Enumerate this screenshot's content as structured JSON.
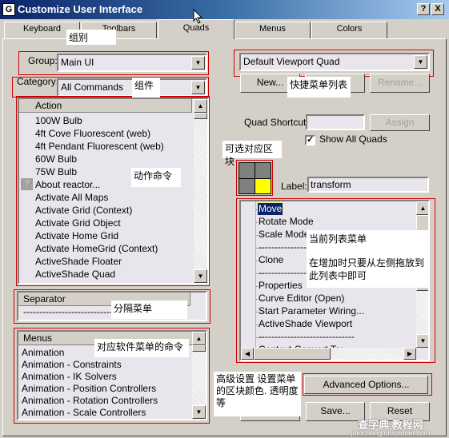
{
  "window": {
    "title": "Customize User Interface",
    "help_label": "?",
    "close_label": "X"
  },
  "tabs": [
    {
      "label": "Keyboard"
    },
    {
      "label": "Toolbars"
    },
    {
      "label": "Quads",
      "active": true
    },
    {
      "label": "Menus"
    },
    {
      "label": "Colors"
    }
  ],
  "left": {
    "group_label": "Group:",
    "group_value": "Main UI",
    "category_label": "Category:",
    "category_value": "All Commands",
    "actions": {
      "header": "Action",
      "items": [
        "100W Bulb",
        "4ft Cove Fluorescent (web)",
        "4ft Pendant Fluorescent (web)",
        "60W Bulb",
        "75W Bulb",
        "About reactor...",
        "Activate All Maps",
        "Activate Grid (Context)",
        "Activate Grid Object",
        "Activate Home Grid",
        "Activate HomeGrid (Context)",
        "ActiveShade Floater",
        "ActiveShade Quad"
      ]
    },
    "separator": {
      "header": "Separator",
      "item": "------------------------------"
    },
    "menus": {
      "header": "Menus",
      "items": [
        "Animation",
        "Animation - Constraints",
        "Animation - IK Solvers",
        "Animation - Position Controllers",
        "Animation - Rotation Controllers",
        "Animation - Scale Controllers"
      ]
    }
  },
  "right": {
    "quad_value": "Default Viewport Quad",
    "new_label": "New...",
    "rename_label": "Rename...",
    "shortcut_label": "Quad Shortcut:",
    "shortcut_value": "",
    "assign_label": "Assign",
    "show_all_label": "Show All Quads",
    "show_all_checked": true,
    "label_label": "Label:",
    "label_value": "transform",
    "quad_selected": "bottom-right",
    "quad_selected_color": "#ffff00",
    "quad_items": [
      "Move",
      "Rotate Mode",
      "Scale Mode",
      "------------------------------",
      "Clone",
      "------------------------------",
      "Properties",
      "Curve Editor (Open)",
      "Start Parameter Wiring...",
      "ActiveShade Viewport",
      "------------------------------",
      "Context Convert To:"
    ],
    "selected_item": "Move",
    "advanced_label": "Advanced Options...",
    "save_label": "Save...",
    "reset_label": "Reset"
  },
  "annotations": {
    "group": "组别",
    "category": "组件",
    "quad_list": "快捷菜单列表",
    "actions": "动作命令",
    "quad_block": "可选对应区块",
    "current_list_1": "当前列表菜单",
    "current_list_2": "在增加时只要从左侧拖放到此列表中即可",
    "separator": "分隔菜单",
    "menus": "对应软件菜单的命令",
    "advanced": "高级设置  设置菜单的区块颜色. 透明度等"
  },
  "watermark": {
    "text": "查字典 教程网",
    "url": "jiaocheng.chazidian.com"
  }
}
